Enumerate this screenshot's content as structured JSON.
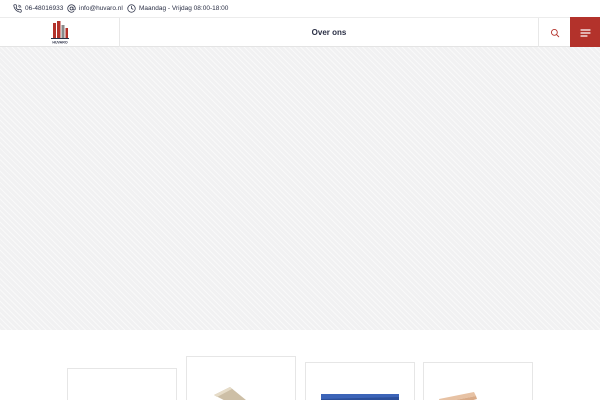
{
  "topbar": {
    "phone": "06-48016933",
    "email": "info@huvaro.nl",
    "hours": "Maandag - Vrijdag 08:00-18:00"
  },
  "header": {
    "logo_text": "HUVARO",
    "nav": [
      {
        "label": "Over ons"
      }
    ]
  },
  "icons": {
    "phone": "phone-icon",
    "email": "at-sign-icon",
    "hours": "clock-icon",
    "search": "search-icon",
    "menu": "hamburger-menu-icon"
  },
  "colors": {
    "brand_red": "#b3322b",
    "text_dark": "#2a2f45",
    "hero_bg": "#f1f1f2"
  }
}
